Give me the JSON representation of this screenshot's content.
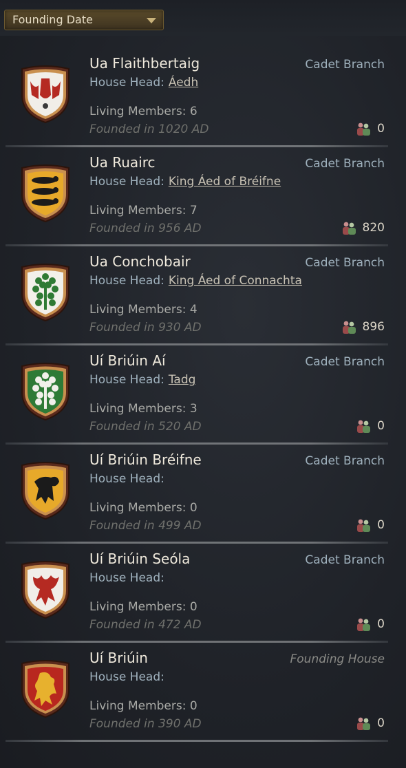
{
  "sort": {
    "label": "Founding Date"
  },
  "houses": [
    {
      "name": "Ua Flaithbertaig",
      "branch": "Cadet Branch",
      "head_label": "House Head:",
      "head_name": "Áedh",
      "living": "Living Members: 6",
      "founded": "Founded in 1020 AD",
      "count": "0",
      "coa": {
        "field": "#f1eee8",
        "charge": "#b52a22",
        "type": "hand-dragons"
      }
    },
    {
      "name": "Ua Ruairc",
      "branch": "Cadet Branch",
      "head_label": "House Head:",
      "head_name": "King Áed of Bréifne",
      "living": "Living Members: 7",
      "founded": "Founded in 956 AD",
      "count": "820",
      "coa": {
        "field": "#e7a92a",
        "charge": "#1b1b1b",
        "type": "lions"
      }
    },
    {
      "name": "Ua Conchobair",
      "branch": "Cadet Branch",
      "head_label": "House Head:",
      "head_name": "King Áed of Connachta",
      "living": "Living Members: 4",
      "founded": "Founded in 930 AD",
      "count": "896",
      "coa": {
        "field": "#f2f0ea",
        "charge": "#2f7a34",
        "type": "tree"
      }
    },
    {
      "name": "Uí Briúin Aí",
      "branch": "Cadet Branch",
      "head_label": "House Head:",
      "head_name": "Tadg",
      "living": "Living Members: 3",
      "founded": "Founded in 520 AD",
      "count": "0",
      "coa": {
        "field": "#2e7a36",
        "charge": "#f1f0ea",
        "type": "tree"
      }
    },
    {
      "name": "Uí Briúin Bréifne",
      "branch": "Cadet Branch",
      "head_label": "House Head:",
      "head_name": "",
      "living": "Living Members: 0",
      "founded": "Founded in 499 AD",
      "count": "0",
      "coa": {
        "field": "#e7a92a",
        "charge": "#1b1b1b",
        "type": "beast"
      }
    },
    {
      "name": "Uí Briúin Seóla",
      "branch": "Cadet Branch",
      "head_label": "House Head:",
      "head_name": "",
      "living": "Living Members: 0",
      "founded": "Founded in 472 AD",
      "count": "0",
      "coa": {
        "field": "#f1eee8",
        "charge": "#b52a22",
        "type": "dragon"
      }
    },
    {
      "name": "Uí Briúin",
      "branch": "Founding House",
      "head_label": "House Head:",
      "head_name": "",
      "living": "Living Members: 0",
      "founded": "Founded in 390 AD",
      "count": "0",
      "coa": {
        "field": "#b8271f",
        "charge": "#e7b12e",
        "type": "lion"
      }
    }
  ]
}
